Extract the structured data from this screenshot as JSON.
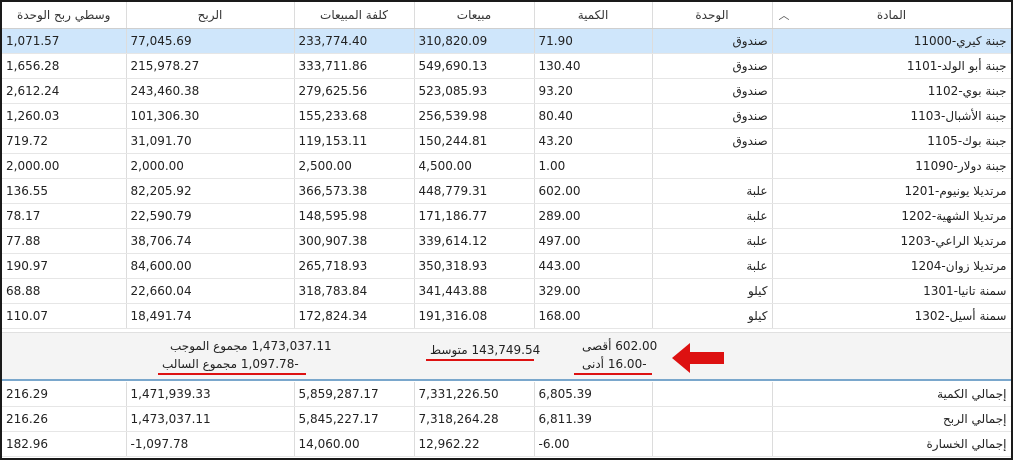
{
  "columns": {
    "item": "المادة",
    "unit": "الوحدة",
    "qty": "الكمية",
    "sales": "مبيعات",
    "cost": "كلفة المبيعات",
    "profit": "الربح",
    "avg_profit": "وسطي ربح الوحدة"
  },
  "rows": [
    {
      "item": "11000-جبنة كيري",
      "unit": "صندوق",
      "qty": "71.90",
      "sales": "310,820.09",
      "cost": "233,774.40",
      "profit": "77,045.69",
      "avg": "1,071.57"
    },
    {
      "item": "1101-جبنة أبو الولد",
      "unit": "صندوق",
      "qty": "130.40",
      "sales": "549,690.13",
      "cost": "333,711.86",
      "profit": "215,978.27",
      "avg": "1,656.28"
    },
    {
      "item": "1102-جبنة بوي",
      "unit": "صندوق",
      "qty": "93.20",
      "sales": "523,085.93",
      "cost": "279,625.56",
      "profit": "243,460.38",
      "avg": "2,612.24"
    },
    {
      "item": "1103-جبنة الأشبال",
      "unit": "صندوق",
      "qty": "80.40",
      "sales": "256,539.98",
      "cost": "155,233.68",
      "profit": "101,306.30",
      "avg": "1,260.03"
    },
    {
      "item": "1105-جبنة بوك",
      "unit": "صندوق",
      "qty": "43.20",
      "sales": "150,244.81",
      "cost": "119,153.11",
      "profit": "31,091.70",
      "avg": "719.72"
    },
    {
      "item": "11090-جبنة دولار",
      "unit": "",
      "qty": "1.00",
      "sales": "4,500.00",
      "cost": "2,500.00",
      "profit": "2,000.00",
      "avg": "2,000.00"
    },
    {
      "item": "1201-مرتديلا يونيوم",
      "unit": "علبة",
      "qty": "602.00",
      "sales": "448,779.31",
      "cost": "366,573.38",
      "profit": "82,205.92",
      "avg": "136.55"
    },
    {
      "item": "1202-مرتديلا الشهية",
      "unit": "علبة",
      "qty": "289.00",
      "sales": "171,186.77",
      "cost": "148,595.98",
      "profit": "22,590.79",
      "avg": "78.17"
    },
    {
      "item": "1203-مرتديلا الراعي",
      "unit": "علبة",
      "qty": "497.00",
      "sales": "339,614.12",
      "cost": "300,907.38",
      "profit": "38,706.74",
      "avg": "77.88"
    },
    {
      "item": "1204-مرتديلا زوان",
      "unit": "علبة",
      "qty": "443.00",
      "sales": "350,318.93",
      "cost": "265,718.93",
      "profit": "84,600.00",
      "avg": "190.97"
    },
    {
      "item": "1301-سمنة تانيا",
      "unit": "كيلو",
      "qty": "329.00",
      "sales": "341,443.88",
      "cost": "318,783.84",
      "profit": "22,660.04",
      "avg": "68.88"
    },
    {
      "item": "1302-سمنة أسيل",
      "unit": "كيلو",
      "qty": "168.00",
      "sales": "191,316.08",
      "cost": "172,824.34",
      "profit": "18,491.74",
      "avg": "110.07"
    }
  ],
  "summary": {
    "max": "602.00 أقصى",
    "min": "-16.00 أدنى",
    "avg": "143,749.54 متوسط",
    "pos_total": "1,473,037.11 مجموع الموجب",
    "neg_total": "-1,097.78 مجموع السالب"
  },
  "totals": [
    {
      "label": "إجمالي الكمية",
      "qty": "6,805.39",
      "sales": "7,331,226.50",
      "cost": "5,859,287.17",
      "profit": "1,471,939.33",
      "avg": "216.29"
    },
    {
      "label": "إجمالي الربح",
      "qty": "6,811.39",
      "sales": "7,318,264.28",
      "cost": "5,845,227.17",
      "profit": "1,473,037.11",
      "avg": "216.26"
    },
    {
      "label": "إجمالي الخسارة",
      "qty": "-6.00",
      "sales": "12,962.22",
      "cost": "14,060.00",
      "profit": "-1,097.78",
      "avg": "182.96"
    }
  ],
  "colors": {
    "selected_row": "#cfe6fb",
    "annotation": "#dd1111"
  },
  "icons": {
    "sort": "chevron-up-icon",
    "arrow": "arrow-right-icon"
  }
}
